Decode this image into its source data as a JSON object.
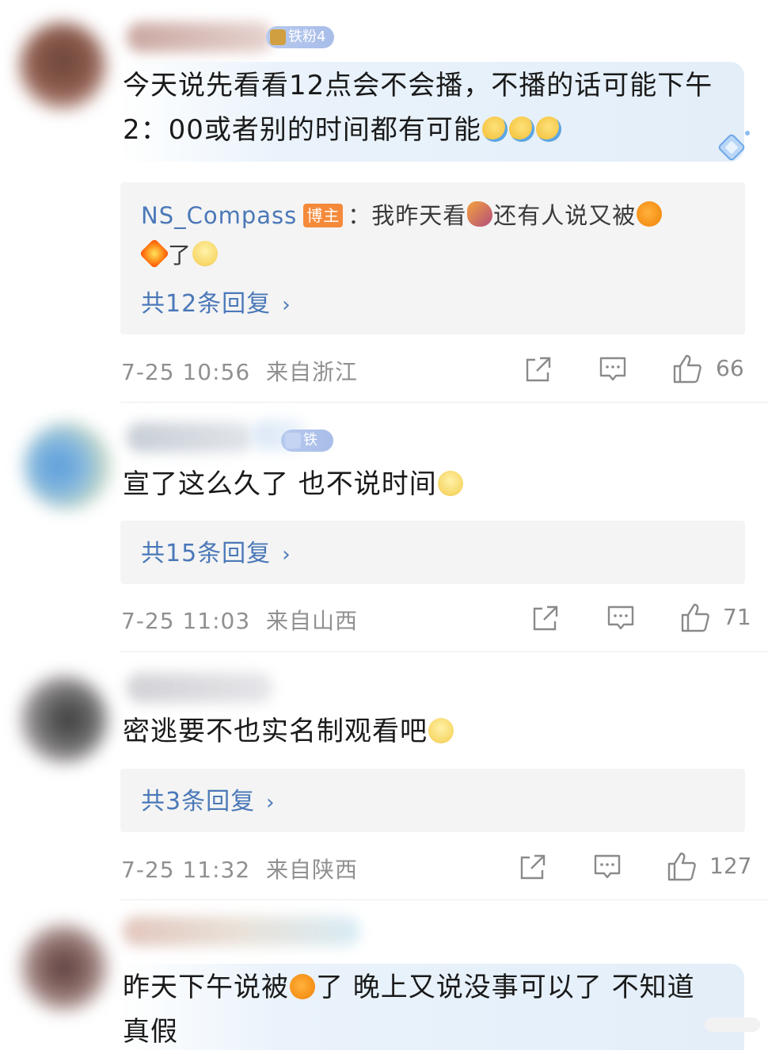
{
  "comments": [
    {
      "badge": "铁粉4",
      "text_pre": "今天说先看看12点会不会播，不播的话可能下午2：00或者别的时间都有可能",
      "reply": {
        "author": "NS_Compass",
        "host_label": "博主",
        "text_a": "：我昨天看",
        "text_b": "还有人说又被",
        "text_c": "了",
        "count_label": "共12条回复"
      },
      "time": "7-25 10:56",
      "location": "来自浙江",
      "likes": "66"
    },
    {
      "badge": "铁粉2",
      "text_pre": "宣了这么久了 也不说时间",
      "reply": {
        "count_label": "共15条回复"
      },
      "time": "7-25 11:03",
      "location": "来自山西",
      "likes": "71"
    },
    {
      "text_pre": "密逃要不也实名制观看吧",
      "reply": {
        "count_label": "共3条回复"
      },
      "time": "7-25 11:32",
      "location": "来自陕西",
      "likes": "127"
    },
    {
      "text_a": "昨天下午说被",
      "text_b": "了 晚上又说没事可以了 不知道",
      "text_c": "真假"
    }
  ],
  "icons": {
    "share": "share-icon",
    "comment": "comment-icon",
    "like": "thumbs-up-icon",
    "chevron": "chevron-right-icon"
  },
  "colors": {
    "link": "#4a78b8",
    "meta": "#909090",
    "reply_bg": "#f4f4f4",
    "host_badge": "#f58a3a",
    "fan_badge": "#a8bde9"
  }
}
